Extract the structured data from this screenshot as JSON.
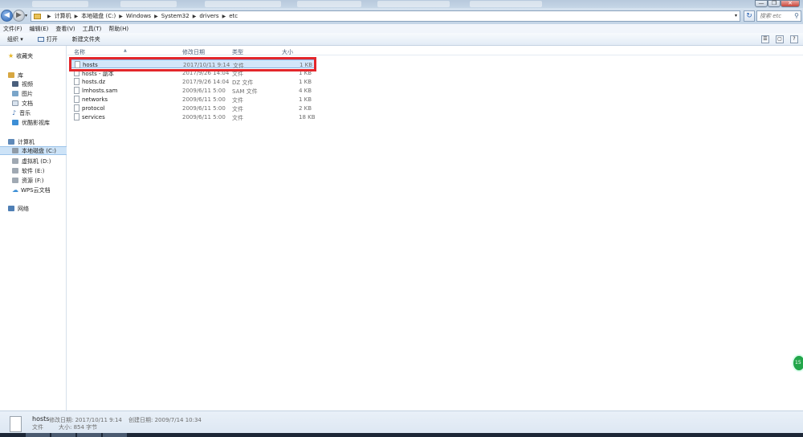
{
  "window": {
    "minimize": "—",
    "close": "✕"
  },
  "address": {
    "crumbs": [
      "计算机",
      "本地磁盘 (C:)",
      "Windows",
      "System32",
      "drivers",
      "etc"
    ],
    "search_placeholder": "搜索 etc"
  },
  "menu": [
    "文件(F)",
    "编辑(E)",
    "查看(V)",
    "工具(T)",
    "帮助(H)"
  ],
  "toolbar": {
    "organize": "组织 ▾",
    "open": "打开",
    "new_folder": "新建文件夹"
  },
  "nav": {
    "favorites": "收藏夹",
    "library": "库",
    "library_items": [
      "视频",
      "图片",
      "文档",
      "音乐",
      "优酷影视库"
    ],
    "computer": "计算机",
    "drives": [
      "本地磁盘 (C:)",
      "虚拟机 (D:)",
      "软件 (E:)",
      "资源 (F:)",
      "WPS云文档"
    ],
    "network": "网络"
  },
  "columns": {
    "name": "名称",
    "modified": "修改日期",
    "type": "类型",
    "size": "大小"
  },
  "files": [
    {
      "name": "hosts",
      "modified": "2017/10/11 9:14",
      "type": "文件",
      "size": "1 KB"
    },
    {
      "name": "hosts - 副本",
      "modified": "2017/9/26 14:04",
      "type": "文件",
      "size": "1 KB"
    },
    {
      "name": "hosts.dz",
      "modified": "2017/9/26 14:04",
      "type": "DZ 文件",
      "size": "1 KB"
    },
    {
      "name": "lmhosts.sam",
      "modified": "2009/6/11 5:00",
      "type": "SAM 文件",
      "size": "4 KB"
    },
    {
      "name": "networks",
      "modified": "2009/6/11 5:00",
      "type": "文件",
      "size": "1 KB"
    },
    {
      "name": "protocol",
      "modified": "2009/6/11 5:00",
      "type": "文件",
      "size": "2 KB"
    },
    {
      "name": "services",
      "modified": "2009/6/11 5:00",
      "type": "文件",
      "size": "18 KB"
    }
  ],
  "details": {
    "name": "hosts",
    "modified": "修改日期: 2017/10/11 9:14",
    "created": "创建日期: 2009/7/14 10:34",
    "type": "文件",
    "size": "大小: 854 字节"
  },
  "badge": "15",
  "colors": {
    "highlight_border": "#e3262b",
    "selection": "#d3e6fa"
  }
}
